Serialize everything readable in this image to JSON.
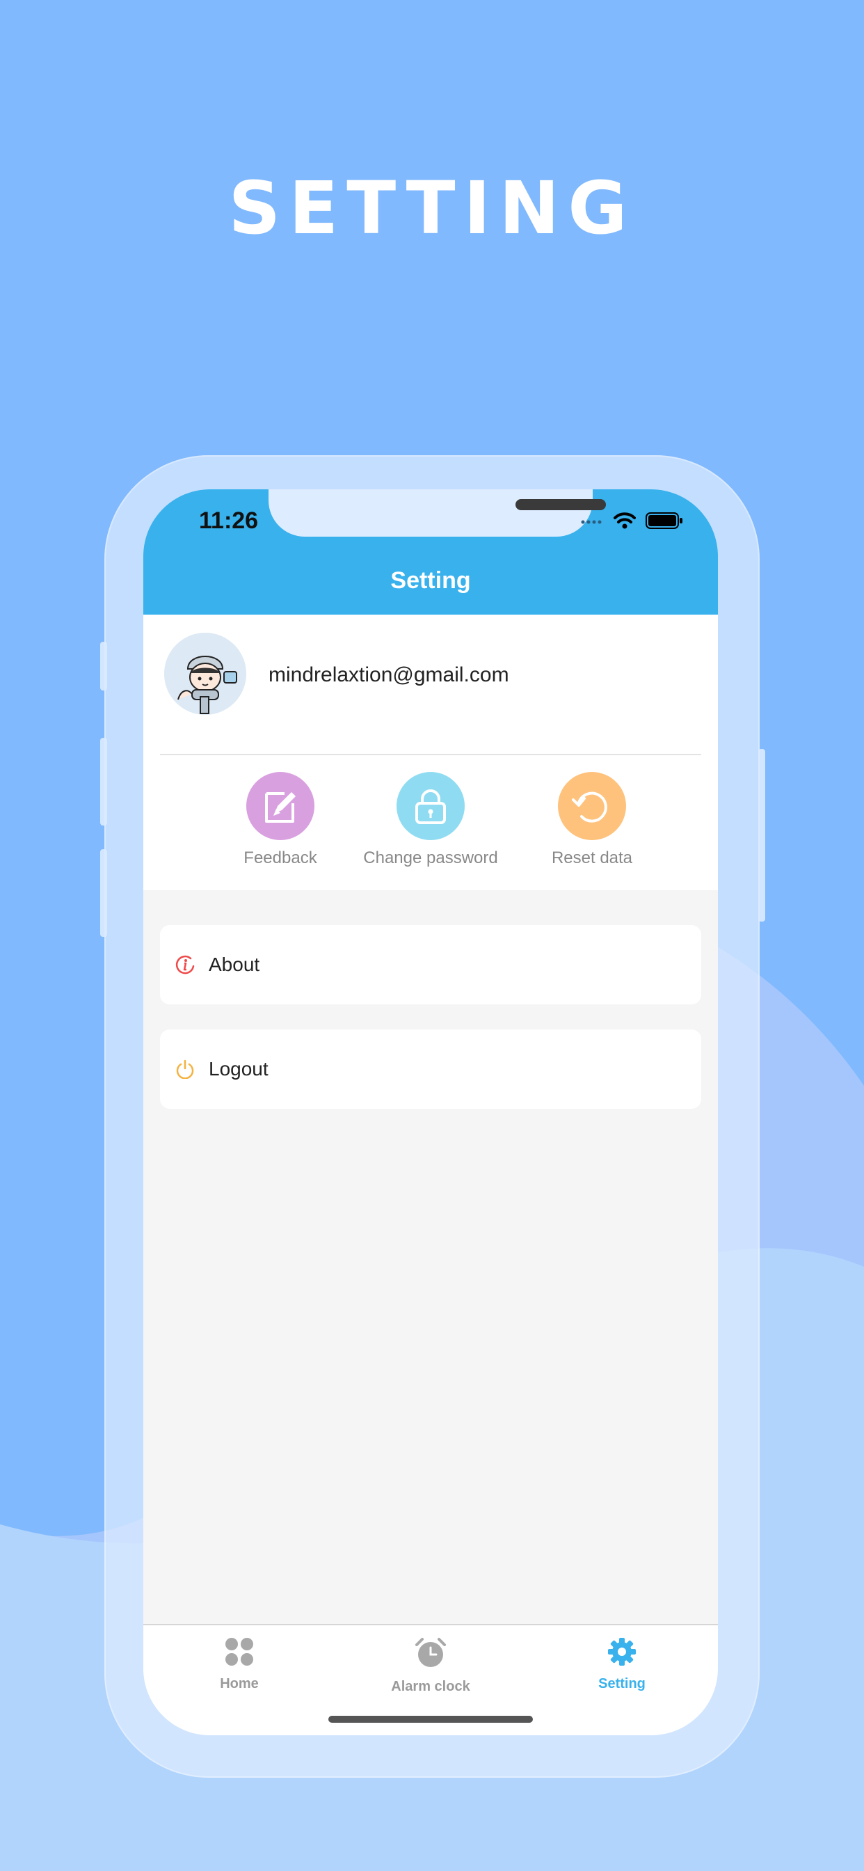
{
  "promo": {
    "headline": "SETTING"
  },
  "status_bar": {
    "time": "11:26"
  },
  "nav": {
    "title": "Setting"
  },
  "profile": {
    "email": "mindrelaxtion@gmail.com",
    "avatar_icon": "avatar-illustration"
  },
  "actions": [
    {
      "label": "Feedback",
      "icon": "edit-icon",
      "color": "#d9a0e0"
    },
    {
      "label": "Change password",
      "icon": "lock-icon",
      "color": "#8fdcf2"
    },
    {
      "label": "Reset data",
      "icon": "refresh-icon",
      "color": "#fec27c"
    }
  ],
  "menu": [
    {
      "label": "About",
      "icon": "info-icon",
      "color": "#ef4a4a"
    },
    {
      "label": "Logout",
      "icon": "power-icon",
      "color": "#f4b23f"
    }
  ],
  "tabbar": [
    {
      "label": "Home",
      "icon": "grid-icon",
      "active": false
    },
    {
      "label": "Alarm clock",
      "icon": "alarm-clock-icon",
      "active": false
    },
    {
      "label": "Setting",
      "icon": "gear-icon",
      "active": true
    }
  ],
  "colors": {
    "accent": "#38b1ec",
    "background": "#80b9fd"
  }
}
